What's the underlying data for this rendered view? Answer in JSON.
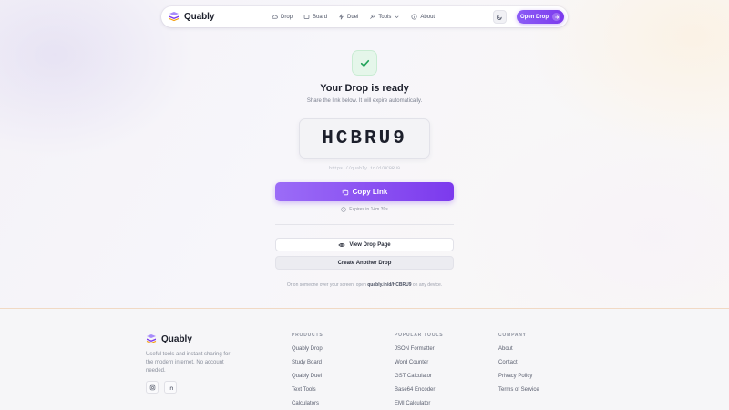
{
  "nav": {
    "brand": "Quably",
    "links": [
      {
        "label": "Drop",
        "icon": "cloud-icon"
      },
      {
        "label": "Board",
        "icon": "board-icon"
      },
      {
        "label": "Duel",
        "icon": "bolt-icon"
      },
      {
        "label": "Tools",
        "icon": "wrench-icon"
      },
      {
        "label": "About",
        "icon": "info-icon"
      }
    ],
    "cta": "Open Drop"
  },
  "main": {
    "title": "Your Drop is ready",
    "subtitle": "Share the link below. It will expire automatically.",
    "code": "HCBRU9",
    "link": "https://quably.in/d/HCBRU9",
    "copy_label": "Copy Link",
    "expires": "Expires in 14m 39s",
    "view_label": "View Drop Page",
    "create_label": "Create Another Drop",
    "hint_prefix": "Or on someone over your screen: open",
    "hint_link": "quably.in/d/HCBRU9",
    "hint_suffix": "on any device."
  },
  "footer": {
    "brand": "Quably",
    "description": "Useful tools and instant sharing for the modern internet. No account needed.",
    "columns": [
      {
        "heading": "PRODUCTS",
        "items": [
          "Quably Drop",
          "Study Board",
          "Quably Duel",
          "Text Tools",
          "Calculators"
        ]
      },
      {
        "heading": "POPULAR TOOLS",
        "items": [
          "JSON Formatter",
          "Word Counter",
          "GST Calculator",
          "Base64 Encoder",
          "EMI Calculator"
        ]
      },
      {
        "heading": "COMPANY",
        "items": [
          "About",
          "Contact",
          "Privacy Policy",
          "Terms of Service"
        ]
      }
    ]
  },
  "colors": {
    "accent": "#7c3aed",
    "success": "#22a35a"
  }
}
